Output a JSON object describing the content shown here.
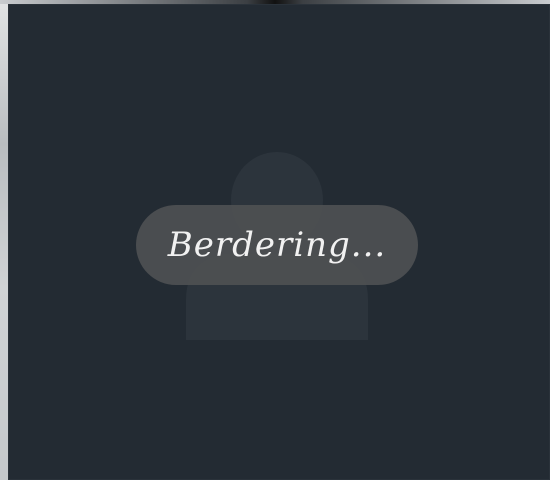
{
  "call": {
    "status": "Berdering..."
  },
  "icons": {
    "avatar": "person-placeholder-icon"
  },
  "colors": {
    "screen_background": "#232b33",
    "avatar_silhouette": "#2c343c",
    "pill_background": "#4e5052",
    "status_text": "#f1f1f1"
  }
}
